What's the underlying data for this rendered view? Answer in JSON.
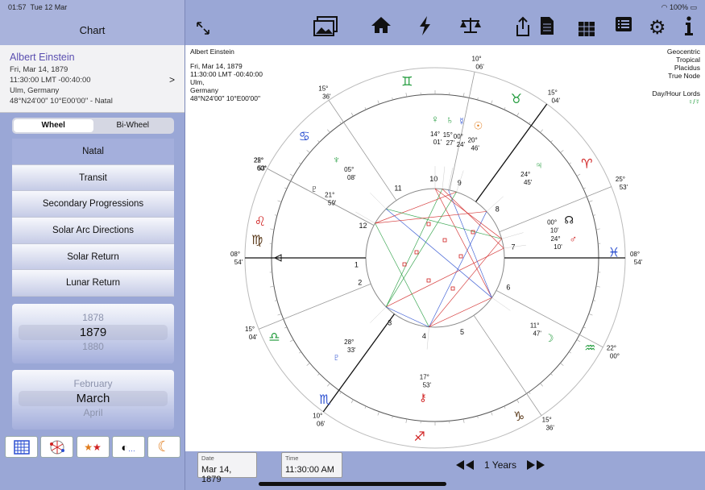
{
  "status": {
    "time": "01:57",
    "date": "Tue 12 Mar",
    "battery": "100%"
  },
  "sidebar": {
    "title": "Chart",
    "person": {
      "name": "Albert Einstein",
      "date": "Fri, Mar 14, 1879",
      "time": "11:30:00 LMT -00:40:00",
      "place": "Ulm, Germany",
      "coords": "48°N24'00\" 10°E00'00\" - Natal"
    },
    "segments": [
      "Wheel",
      "Bi-Wheel"
    ],
    "menu": [
      "Natal",
      "Transit",
      "Secondary Progressions",
      "Solar Arc Directions",
      "Solar Return",
      "Lunar Return"
    ],
    "year_picker": [
      "1878",
      "1879",
      "1880"
    ],
    "month_picker": [
      "February",
      "March",
      "April"
    ],
    "tools": [
      "grid-icon",
      "aspect-pattern-icon",
      "stars-icon",
      "eclipse-icon",
      "moon-icon"
    ]
  },
  "toolbar": [
    "expand-icon",
    "gallery-icon",
    "home-icon",
    "lightning-icon",
    "scales-icon",
    "share-icon",
    "document-icon",
    "grid-icon",
    "list-icon",
    "settings-icon",
    "info-icon"
  ],
  "chart_info": {
    "left": [
      "Albert Einstein",
      "Fri, Mar 14, 1879",
      "11:30:00 LMT -00:40:00",
      "Ulm,",
      "Germany",
      "48°N24'00\" 10°E00'00\""
    ],
    "right": [
      "Geocentric",
      "Tropical",
      "Placidus",
      "True Node"
    ],
    "day_hour": "Day/Hour Lords",
    "day_hour_value": "♀/☿"
  },
  "wheel": {
    "cusps": [
      {
        "a": 180,
        "deg": "08°",
        "min": "54'"
      },
      {
        "a": 152,
        "deg": "22°",
        "min": "00°"
      },
      {
        "a": 124,
        "deg": "15°",
        "min": "36'"
      },
      {
        "a": 54,
        "deg": "15°",
        "min": "04'"
      },
      {
        "a": 22,
        "deg": "25°",
        "min": "53'"
      },
      {
        "a": 0,
        "deg": "08°",
        "min": "54'"
      },
      {
        "a": -28,
        "deg": "22°",
        "min": "00°"
      },
      {
        "a": -56,
        "deg": "15°",
        "min": "36'"
      },
      {
        "a": -126,
        "deg": "10°",
        "min": "06'"
      },
      {
        "a": -158,
        "deg": "15°",
        "min": "04'"
      },
      {
        "a": -208,
        "deg": "25°",
        "min": "53'"
      },
      {
        "a": 78,
        "deg": "10°",
        "min": "06'"
      }
    ],
    "signs": [
      {
        "a": 99,
        "g": "♊",
        "c": "#1f9a3a"
      },
      {
        "a": 63,
        "g": "♉",
        "c": "#1f9a3a"
      },
      {
        "a": 32,
        "g": "♈",
        "c": "#d02020"
      },
      {
        "a": 2,
        "g": "♓",
        "c": "#2b4fd0"
      },
      {
        "a": -30,
        "g": "♒",
        "c": "#1f9a3a"
      },
      {
        "a": -62,
        "g": "♑",
        "c": "#5a3a1a"
      },
      {
        "a": -95,
        "g": "♐",
        "c": "#d02020"
      },
      {
        "a": -128,
        "g": "♏",
        "c": "#2b4fd0"
      },
      {
        "a": -154,
        "g": "♎",
        "c": "#1f9a3a"
      },
      {
        "a": -186,
        "g": "♍",
        "c": "#5a3a1a"
      },
      {
        "a": 168,
        "g": "♌",
        "c": "#d02020"
      },
      {
        "a": 137,
        "g": "♋",
        "c": "#2b4fd0"
      }
    ],
    "houses": [
      "1",
      "2",
      "3",
      "4",
      "5",
      "6",
      "7",
      "8",
      "9",
      "10",
      "11",
      "12"
    ],
    "planets": [
      {
        "a": 90,
        "g": "♀",
        "c": "#1f9a3a",
        "deg": "14°",
        "min": "01'"
      },
      {
        "a": 84,
        "g": "♄",
        "c": "#1f9a3a",
        "deg": "15°",
        "min": "27'"
      },
      {
        "a": 79,
        "g": "☿",
        "c": "#2b4fd0",
        "deg": "00°",
        "min": "24'"
      },
      {
        "a": 72,
        "g": "☉",
        "c": "#e07b1a",
        "deg": "20°",
        "min": "46'"
      },
      {
        "a": 42,
        "g": "♃",
        "c": "#1f9a3a",
        "deg": "24°",
        "min": "45'"
      },
      {
        "a": 16,
        "g": "☊",
        "c": "#111",
        "deg": "00°",
        "min": "10'"
      },
      {
        "a": 8,
        "g": "♂",
        "c": "#d02020",
        "deg": "24°",
        "min": "10'"
      },
      {
        "a": -35,
        "g": "☽",
        "c": "#1f9a3a",
        "deg": "11°",
        "min": "47'"
      },
      {
        "a": -95,
        "g": "⚷",
        "c": "#d02020",
        "deg": "17°",
        "min": "53'"
      },
      {
        "a": -135,
        "g": "♇",
        "c": "#2b4fd0",
        "deg": "28°",
        "min": "33'"
      },
      {
        "a": 135,
        "g": "♆",
        "c": "#1f9a3a",
        "deg": "05°",
        "min": "08'"
      },
      {
        "a": 150,
        "g": "♇",
        "c": "#111",
        "deg": "21°",
        "min": "59'"
      }
    ]
  },
  "bottom": {
    "date_label": "Date",
    "date_value": "Mar 14, 1879",
    "time_label": "Time",
    "time_value": "11:30:00 AM",
    "period": "1 Years"
  }
}
